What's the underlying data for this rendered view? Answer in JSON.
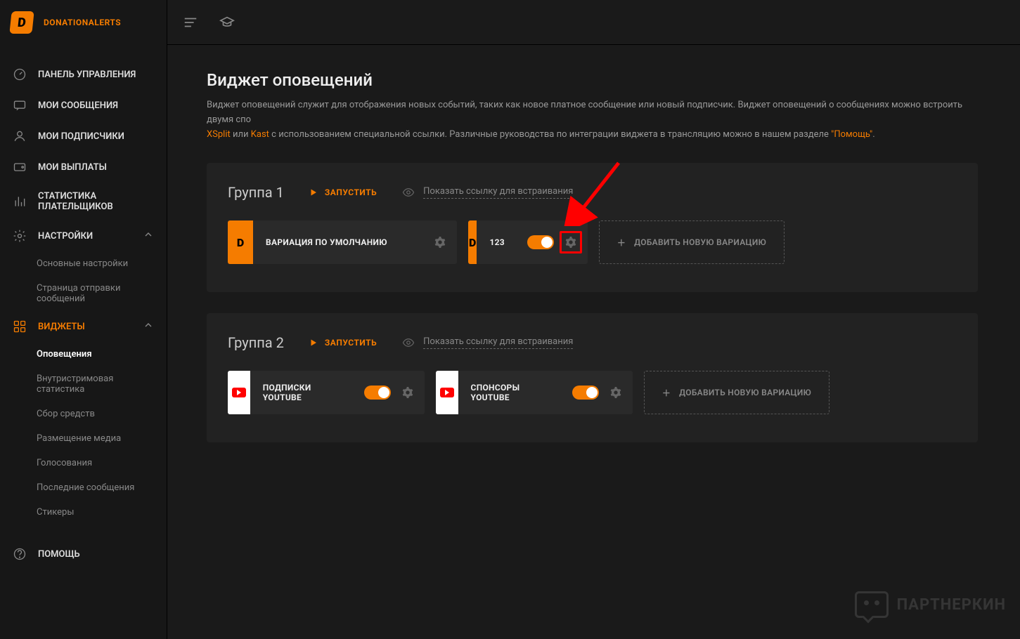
{
  "brand": "DONATIONALERTS",
  "sidebar": {
    "dashboard": "ПАНЕЛЬ УПРАВЛЕНИЯ",
    "messages": "МОИ СООБЩЕНИЯ",
    "subscribers": "МОИ ПОДПИСЧИКИ",
    "payouts": "МОИ ВЫПЛАТЫ",
    "stats": "СТАТИСТИКА ПЛАТЕЛЬЩИКОВ",
    "settings": "НАСТРОЙКИ",
    "settings_sub": {
      "general": "Основные настройки",
      "sendpage": "Страница отправки сообщений"
    },
    "widgets": "ВИДЖЕТЫ",
    "widgets_sub": {
      "alerts": "Оповещения",
      "streamstats": "Внутристримовая статистика",
      "crowdfund": "Сбор средств",
      "media": "Размещение медиа",
      "polls": "Голосования",
      "recent": "Последние сообщения",
      "stickers": "Стикеры"
    },
    "help": "ПОМОЩЬ"
  },
  "page": {
    "title": "Виджет оповещений",
    "desc1": "Виджет оповещений служит для отображения новых событий, таких как новое платное сообщение или новый подписчик. Виджет оповещений о сообщениях можно встроить двумя спо",
    "desc_xsplit": "XSplit",
    "desc_or": " или ",
    "desc_kast": "Kast",
    "desc2": " с использованием специальной ссылки. Различные руководства по интеграции виджета в трансляцию можно в нашем разделе ",
    "desc_help": "\"Помощь\"",
    "desc_end": "."
  },
  "common": {
    "launch": "ЗАПУСТИТЬ",
    "embed": "Показать ссылку для встраивания",
    "add": "ДОБАВИТЬ НОВУЮ ВАРИАЦИЮ"
  },
  "group1": {
    "title": "Группа 1",
    "cards": {
      "default": "ВАРИАЦИЯ ПО УМОЛЧАНИЮ",
      "v2": "123"
    }
  },
  "group2": {
    "title": "Группа 2",
    "cards": {
      "yt_sub": "ПОДПИСКИ YOUTUBE",
      "yt_spons": "СПОНСОРЫ YOUTUBE"
    }
  },
  "watermark": "ПАРТНЕРКИН"
}
